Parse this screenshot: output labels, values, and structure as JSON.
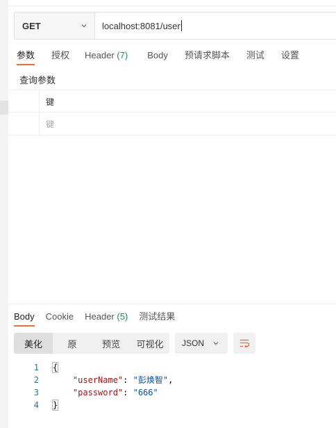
{
  "request": {
    "method": "GET",
    "url": "localhost:8081/user"
  },
  "request_tabs": [
    {
      "label": "参数",
      "count": ""
    },
    {
      "label": "授权",
      "count": ""
    },
    {
      "label": "Header",
      "count": "(7)"
    },
    {
      "label": "Body",
      "count": ""
    },
    {
      "label": "预请求脚本",
      "count": ""
    },
    {
      "label": "测试",
      "count": ""
    },
    {
      "label": "设置",
      "count": ""
    }
  ],
  "params": {
    "title": "查询参数",
    "column_key": "键",
    "key_placeholder": "键"
  },
  "response_tabs": [
    {
      "label": "Body",
      "count": ""
    },
    {
      "label": "Cookie",
      "count": ""
    },
    {
      "label": "Header",
      "count": "(5)"
    },
    {
      "label": "测试结果",
      "count": ""
    }
  ],
  "view_modes": [
    "美化",
    "原",
    "预览",
    "可视化"
  ],
  "format": "JSON",
  "code": {
    "line_numbers": [
      "1",
      "2",
      "3",
      "4"
    ],
    "open_brace": "{",
    "close_brace": "}",
    "key1": "\"userName\"",
    "val1": "\"彭焕智\"",
    "key2": "\"password\"",
    "val2": "\"666\""
  },
  "colors": {
    "accent": "#f26b3a",
    "count": "#1e8c5a"
  }
}
